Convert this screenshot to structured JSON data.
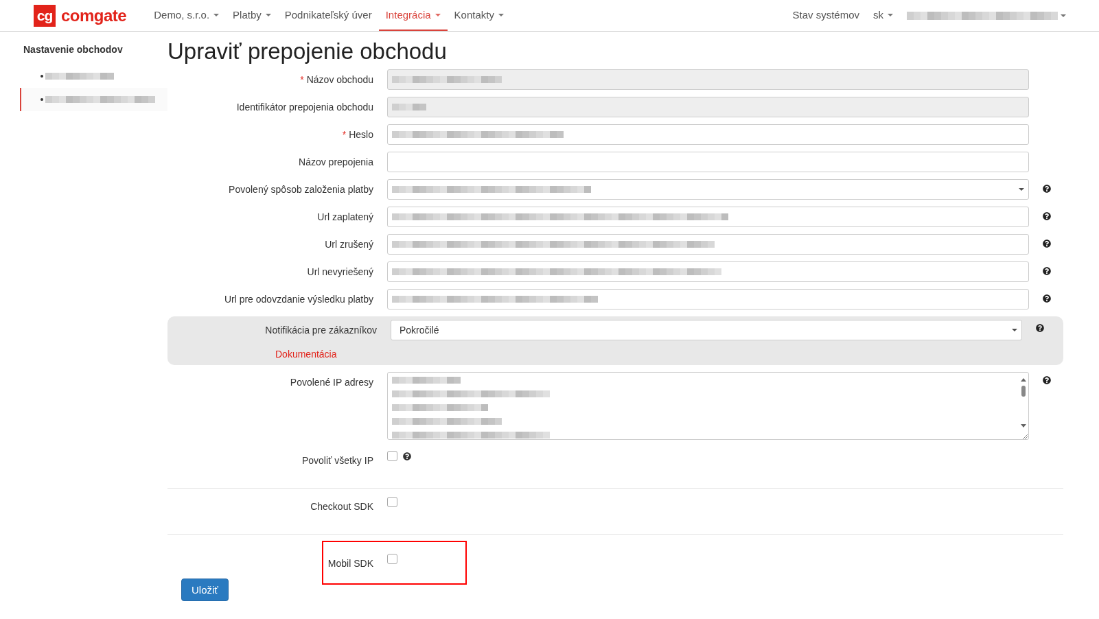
{
  "navbar": {
    "logo": {
      "mark": "cg",
      "name": "comgate"
    },
    "menu": [
      {
        "label": "Demo, s.r.o.",
        "dropdown": true,
        "selected": false
      },
      {
        "label": "Platby",
        "dropdown": true,
        "selected": false
      },
      {
        "label": "Podnikateľský úver",
        "dropdown": false,
        "selected": false
      },
      {
        "label": "Integrácia",
        "dropdown": true,
        "selected": true
      },
      {
        "label": "Kontakty",
        "dropdown": true,
        "selected": false
      }
    ],
    "right": [
      {
        "label": "Stav systémov",
        "dropdown": false
      },
      {
        "label": "sk",
        "dropdown": true
      }
    ]
  },
  "sidebar": {
    "title": "Nastavenie obchodov",
    "items": [
      {
        "selected": false
      },
      {
        "selected": true
      }
    ]
  },
  "page_title": "Upraviť prepojenie obchodu",
  "fields": [
    {
      "kind": "text",
      "label": "Názov obchodu",
      "marker": "*",
      "disabled": true,
      "value_hidden": true,
      "help": false
    },
    {
      "kind": "text",
      "label": "Identifikátor prepojenia obchodu",
      "disabled": true,
      "value_hidden": true,
      "help": false
    },
    {
      "kind": "text",
      "label": "Heslo",
      "marker": "*",
      "disabled": false,
      "value_hidden": true,
      "help": false
    },
    {
      "kind": "text",
      "label": "Názov prepojenia",
      "disabled": false,
      "value_hidden": false,
      "help": false
    },
    {
      "kind": "select",
      "label": "Povolený spôsob založenia platby",
      "disabled": false,
      "value_hidden": true,
      "help": true
    },
    {
      "kind": "text",
      "label": "Url zaplatený",
      "disabled": false,
      "value_hidden": true,
      "help": true
    },
    {
      "kind": "text",
      "label": "Url zrušený",
      "disabled": false,
      "value_hidden": true,
      "help": true
    },
    {
      "kind": "text",
      "label": "Url nevyriešený",
      "disabled": false,
      "value_hidden": true,
      "help": true
    },
    {
      "kind": "text",
      "label": "Url pre odovzdanie výsledku platby",
      "disabled": false,
      "value_hidden": true,
      "help": true
    },
    {
      "kind": "panel-select",
      "label": "Notifikácia pre zákazníkov",
      "value": "Pokročilé",
      "link": "Dokumentácia",
      "help": true
    },
    {
      "kind": "textarea",
      "label": "Povolené IP adresy",
      "value_hidden": true,
      "help": true
    },
    {
      "kind": "checkbox",
      "label": "Povoliť všetky IP",
      "checked": false,
      "help": true,
      "divider_before": false,
      "highlighted": false
    },
    {
      "kind": "checkbox",
      "label": "Checkout SDK",
      "checked": false,
      "help": false,
      "divider_before": true,
      "highlighted": false
    },
    {
      "kind": "checkbox",
      "label": "Mobil SDK",
      "checked": false,
      "help": false,
      "divider_before": true,
      "highlighted": true
    }
  ],
  "save_button": "Uložiť"
}
